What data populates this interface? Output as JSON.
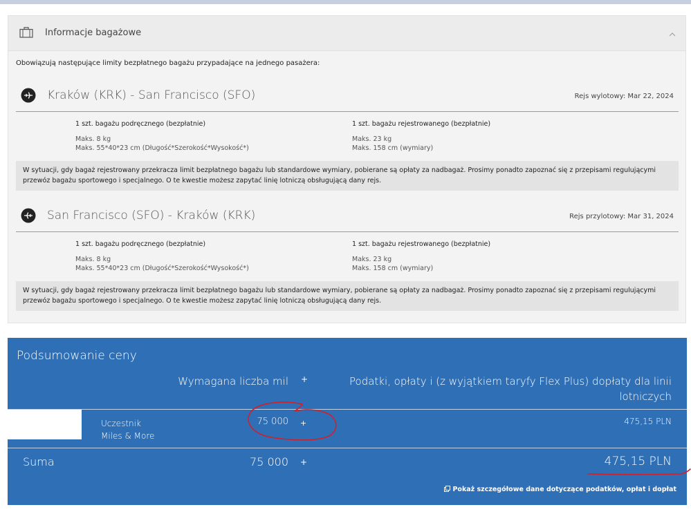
{
  "baggage": {
    "title": "Informacje bagażowe",
    "intro": "Obowiązują następujące limity bezpłatnego bagażu przypadające na jednego pasażera:",
    "routes": [
      {
        "title": "Kraków (KRK) - San Francisco (SFO)",
        "date": "Rejs wylotowy: Mar 22, 2024",
        "carry_on": {
          "head": "1 szt. bagażu podręcznego (bezpłatnie)",
          "line1": "Maks. 8 kg",
          "line2": "Maks. 55*40*23 cm (Długość*Szerokość*Wysokość*)"
        },
        "checked": {
          "head": "1 szt. bagażu rejestrowanego (bezpłatnie)",
          "line1": "Maks. 23 kg",
          "line2": "Maks. 158 cm (wymiary)"
        },
        "note": "W sytuacji, gdy bagaż rejestrowany przekracza limit bezpłatnego bagażu lub standardowe wymiary, pobierane są opłaty za nadbagaż. Prosimy ponadto zapoznać się z przepisami regulującymi przewóz bagażu sportowego i specjalnego. O te kwestie możesz zapytać linię lotniczą obsługującą dany rejs."
      },
      {
        "title": "San Francisco (SFO) - Kraków (KRK)",
        "date": "Rejs przylotowy: Mar 31, 2024",
        "carry_on": {
          "head": "1 szt. bagażu podręcznego (bezpłatnie)",
          "line1": "Maks. 8 kg",
          "line2": "Maks. 55*40*23 cm (Długość*Szerokość*Wysokość*)"
        },
        "checked": {
          "head": "1 szt. bagażu rejestrowanego (bezpłatnie)",
          "line1": "Maks. 23 kg",
          "line2": "Maks. 158 cm (wymiary)"
        },
        "note": "W sytuacji, gdy bagaż rejestrowany przekracza limit bezpłatnego bagażu lub standardowe wymiary, pobierane są opłaty za nadbagaż. Prosimy ponadto zapoznać się z przepisami regulującymi przewóz bagażu sportowego i specjalnego. O te kwestie możesz zapytać linię lotniczą obsługującą dany rejs."
      }
    ]
  },
  "price": {
    "title": "Podsumowanie ceny",
    "col_miles": "Wymagana liczba mil",
    "plus": "+",
    "col_taxes": "Podatki, opłaty i (z wyjątkiem taryfy Flex Plus) dopłaty dla linii lotniczych",
    "participant_line1": "Uczestnik",
    "participant_line2": "Miles & More",
    "participant_miles": "75 000",
    "participant_tax": "475,15 PLN",
    "sum_label": "Suma",
    "sum_miles": "75 000",
    "sum_tax": "475,15 PLN",
    "details_link": "Pokaż szczegółowe dane dotyczące podatków, opłat i dopłat"
  },
  "colors": {
    "summary_blue": "#2f6fb6",
    "annotation_red": "#d0202a"
  }
}
